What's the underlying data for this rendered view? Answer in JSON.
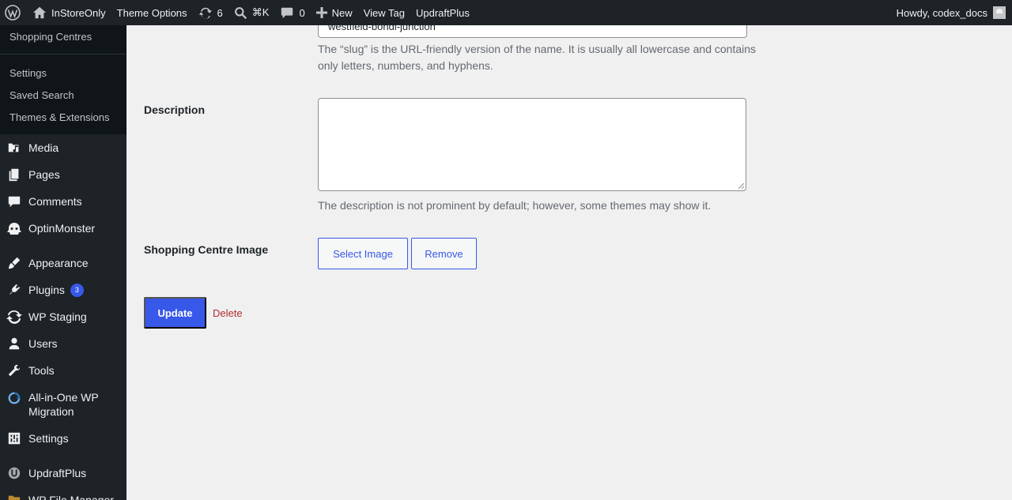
{
  "adminbar": {
    "site_name": "InStoreOnly",
    "theme_options": "Theme Options",
    "updates_count": "6",
    "search_shortcut": "⌘K",
    "comments_count": "0",
    "new_label": "New",
    "view_tag": "View Tag",
    "updraftplus": "UpdraftPlus",
    "howdy": "Howdy, codex_docs"
  },
  "sidebar": {
    "submenu": {
      "top_item": "Shopping Centres",
      "items": [
        "Settings",
        "Saved Search",
        "Themes & Extensions"
      ]
    },
    "menu": [
      {
        "label": "Media",
        "icon": "media-icon"
      },
      {
        "label": "Pages",
        "icon": "pages-icon"
      },
      {
        "label": "Comments",
        "icon": "comments-icon"
      },
      {
        "label": "OptinMonster",
        "icon": "optinmonster-icon"
      },
      {
        "label": "Appearance",
        "icon": "appearance-icon"
      },
      {
        "label": "Plugins",
        "icon": "plugins-icon",
        "badge": "3"
      },
      {
        "label": "WP Staging",
        "icon": "wp-staging-icon"
      },
      {
        "label": "Users",
        "icon": "users-icon"
      },
      {
        "label": "Tools",
        "icon": "tools-icon"
      },
      {
        "label": "All-in-One WP Migration",
        "icon": "migration-icon"
      },
      {
        "label": "Settings",
        "icon": "settings-icon"
      },
      {
        "label": "UpdraftPlus",
        "icon": "updraftplus-icon"
      },
      {
        "label": "WP File Manager",
        "icon": "file-manager-icon"
      }
    ]
  },
  "form": {
    "slug_value": "westfield-bondi-junction",
    "slug_help": "The “slug” is the URL-friendly version of the name. It is usually all lowercase and contains only letters, numbers, and hyphens.",
    "description_label": "Description",
    "description_value": "",
    "description_help": "The description is not prominent by default; however, some themes may show it.",
    "image_label": "Shopping Centre Image",
    "select_image": "Select Image",
    "remove": "Remove",
    "update": "Update",
    "delete": "Delete"
  },
  "colors": {
    "accent": "#3858e9",
    "delete": "#b32d2e",
    "adminbar_bg": "#1d2327",
    "content_bg": "#f0f0f1"
  }
}
